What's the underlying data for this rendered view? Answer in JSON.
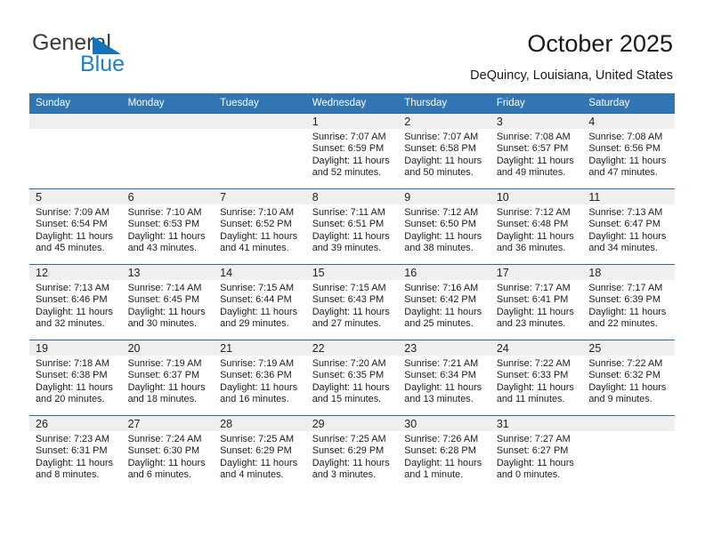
{
  "brand": {
    "name_part1": "General",
    "name_part2": "Blue"
  },
  "header": {
    "title": "October 2025",
    "location": "DeQuincy, Louisiana, United States"
  },
  "weekday_headers": [
    "Sunday",
    "Monday",
    "Tuesday",
    "Wednesday",
    "Thursday",
    "Friday",
    "Saturday"
  ],
  "colors": {
    "header_blue": "#3175b4",
    "rule_blue": "#2e6da4",
    "daynum_gray": "#efefef",
    "brand_blue": "#1f7fc4",
    "brand_dark": "#3b3b3b"
  },
  "weeks": [
    [
      {
        "day": "",
        "empty": true
      },
      {
        "day": "",
        "empty": true
      },
      {
        "day": "",
        "empty": true
      },
      {
        "day": "1",
        "sunrise": "Sunrise: 7:07 AM",
        "sunset": "Sunset: 6:59 PM",
        "daylight1": "Daylight: 11 hours",
        "daylight2": "and 52 minutes."
      },
      {
        "day": "2",
        "sunrise": "Sunrise: 7:07 AM",
        "sunset": "Sunset: 6:58 PM",
        "daylight1": "Daylight: 11 hours",
        "daylight2": "and 50 minutes."
      },
      {
        "day": "3",
        "sunrise": "Sunrise: 7:08 AM",
        "sunset": "Sunset: 6:57 PM",
        "daylight1": "Daylight: 11 hours",
        "daylight2": "and 49 minutes."
      },
      {
        "day": "4",
        "sunrise": "Sunrise: 7:08 AM",
        "sunset": "Sunset: 6:56 PM",
        "daylight1": "Daylight: 11 hours",
        "daylight2": "and 47 minutes."
      }
    ],
    [
      {
        "day": "5",
        "sunrise": "Sunrise: 7:09 AM",
        "sunset": "Sunset: 6:54 PM",
        "daylight1": "Daylight: 11 hours",
        "daylight2": "and 45 minutes."
      },
      {
        "day": "6",
        "sunrise": "Sunrise: 7:10 AM",
        "sunset": "Sunset: 6:53 PM",
        "daylight1": "Daylight: 11 hours",
        "daylight2": "and 43 minutes."
      },
      {
        "day": "7",
        "sunrise": "Sunrise: 7:10 AM",
        "sunset": "Sunset: 6:52 PM",
        "daylight1": "Daylight: 11 hours",
        "daylight2": "and 41 minutes."
      },
      {
        "day": "8",
        "sunrise": "Sunrise: 7:11 AM",
        "sunset": "Sunset: 6:51 PM",
        "daylight1": "Daylight: 11 hours",
        "daylight2": "and 39 minutes."
      },
      {
        "day": "9",
        "sunrise": "Sunrise: 7:12 AM",
        "sunset": "Sunset: 6:50 PM",
        "daylight1": "Daylight: 11 hours",
        "daylight2": "and 38 minutes."
      },
      {
        "day": "10",
        "sunrise": "Sunrise: 7:12 AM",
        "sunset": "Sunset: 6:48 PM",
        "daylight1": "Daylight: 11 hours",
        "daylight2": "and 36 minutes."
      },
      {
        "day": "11",
        "sunrise": "Sunrise: 7:13 AM",
        "sunset": "Sunset: 6:47 PM",
        "daylight1": "Daylight: 11 hours",
        "daylight2": "and 34 minutes."
      }
    ],
    [
      {
        "day": "12",
        "sunrise": "Sunrise: 7:13 AM",
        "sunset": "Sunset: 6:46 PM",
        "daylight1": "Daylight: 11 hours",
        "daylight2": "and 32 minutes."
      },
      {
        "day": "13",
        "sunrise": "Sunrise: 7:14 AM",
        "sunset": "Sunset: 6:45 PM",
        "daylight1": "Daylight: 11 hours",
        "daylight2": "and 30 minutes."
      },
      {
        "day": "14",
        "sunrise": "Sunrise: 7:15 AM",
        "sunset": "Sunset: 6:44 PM",
        "daylight1": "Daylight: 11 hours",
        "daylight2": "and 29 minutes."
      },
      {
        "day": "15",
        "sunrise": "Sunrise: 7:15 AM",
        "sunset": "Sunset: 6:43 PM",
        "daylight1": "Daylight: 11 hours",
        "daylight2": "and 27 minutes."
      },
      {
        "day": "16",
        "sunrise": "Sunrise: 7:16 AM",
        "sunset": "Sunset: 6:42 PM",
        "daylight1": "Daylight: 11 hours",
        "daylight2": "and 25 minutes."
      },
      {
        "day": "17",
        "sunrise": "Sunrise: 7:17 AM",
        "sunset": "Sunset: 6:41 PM",
        "daylight1": "Daylight: 11 hours",
        "daylight2": "and 23 minutes."
      },
      {
        "day": "18",
        "sunrise": "Sunrise: 7:17 AM",
        "sunset": "Sunset: 6:39 PM",
        "daylight1": "Daylight: 11 hours",
        "daylight2": "and 22 minutes."
      }
    ],
    [
      {
        "day": "19",
        "sunrise": "Sunrise: 7:18 AM",
        "sunset": "Sunset: 6:38 PM",
        "daylight1": "Daylight: 11 hours",
        "daylight2": "and 20 minutes."
      },
      {
        "day": "20",
        "sunrise": "Sunrise: 7:19 AM",
        "sunset": "Sunset: 6:37 PM",
        "daylight1": "Daylight: 11 hours",
        "daylight2": "and 18 minutes."
      },
      {
        "day": "21",
        "sunrise": "Sunrise: 7:19 AM",
        "sunset": "Sunset: 6:36 PM",
        "daylight1": "Daylight: 11 hours",
        "daylight2": "and 16 minutes."
      },
      {
        "day": "22",
        "sunrise": "Sunrise: 7:20 AM",
        "sunset": "Sunset: 6:35 PM",
        "daylight1": "Daylight: 11 hours",
        "daylight2": "and 15 minutes."
      },
      {
        "day": "23",
        "sunrise": "Sunrise: 7:21 AM",
        "sunset": "Sunset: 6:34 PM",
        "daylight1": "Daylight: 11 hours",
        "daylight2": "and 13 minutes."
      },
      {
        "day": "24",
        "sunrise": "Sunrise: 7:22 AM",
        "sunset": "Sunset: 6:33 PM",
        "daylight1": "Daylight: 11 hours",
        "daylight2": "and 11 minutes."
      },
      {
        "day": "25",
        "sunrise": "Sunrise: 7:22 AM",
        "sunset": "Sunset: 6:32 PM",
        "daylight1": "Daylight: 11 hours",
        "daylight2": "and 9 minutes."
      }
    ],
    [
      {
        "day": "26",
        "sunrise": "Sunrise: 7:23 AM",
        "sunset": "Sunset: 6:31 PM",
        "daylight1": "Daylight: 11 hours",
        "daylight2": "and 8 minutes."
      },
      {
        "day": "27",
        "sunrise": "Sunrise: 7:24 AM",
        "sunset": "Sunset: 6:30 PM",
        "daylight1": "Daylight: 11 hours",
        "daylight2": "and 6 minutes."
      },
      {
        "day": "28",
        "sunrise": "Sunrise: 7:25 AM",
        "sunset": "Sunset: 6:29 PM",
        "daylight1": "Daylight: 11 hours",
        "daylight2": "and 4 minutes."
      },
      {
        "day": "29",
        "sunrise": "Sunrise: 7:25 AM",
        "sunset": "Sunset: 6:29 PM",
        "daylight1": "Daylight: 11 hours",
        "daylight2": "and 3 minutes."
      },
      {
        "day": "30",
        "sunrise": "Sunrise: 7:26 AM",
        "sunset": "Sunset: 6:28 PM",
        "daylight1": "Daylight: 11 hours",
        "daylight2": "and 1 minute."
      },
      {
        "day": "31",
        "sunrise": "Sunrise: 7:27 AM",
        "sunset": "Sunset: 6:27 PM",
        "daylight1": "Daylight: 11 hours",
        "daylight2": "and 0 minutes."
      },
      {
        "day": "",
        "empty": true
      }
    ]
  ]
}
